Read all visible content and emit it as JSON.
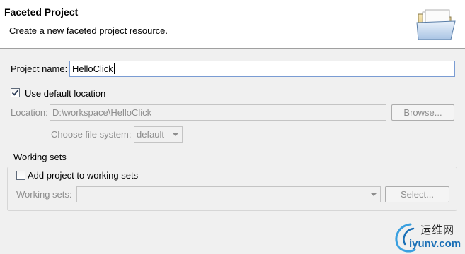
{
  "banner": {
    "title": "Faceted Project",
    "description": "Create a new faceted project resource.",
    "icon": "folder-open-icon"
  },
  "project_name": {
    "label": "Project name:",
    "value": "HelloClick"
  },
  "use_default_location": {
    "label": "Use default location",
    "checked": true
  },
  "location": {
    "label": "Location:",
    "value": "D:\\workspace\\HelloClick",
    "browse_label": "Browse...",
    "enabled": false
  },
  "file_system": {
    "label": "Choose file system:",
    "selected": "default"
  },
  "working_sets": {
    "group_title": "Working sets",
    "add_label": "Add project to working sets",
    "add_checked": false,
    "sets_label": "Working sets:",
    "sets_value": "",
    "select_label": "Select..."
  },
  "watermark": {
    "chinese": "运维网",
    "domain": "iyunv.com"
  },
  "colors": {
    "accent_border": "#7a9cd3",
    "disabled_text": "#8d8d8d",
    "watermark_blue": "#1a6fb6"
  }
}
